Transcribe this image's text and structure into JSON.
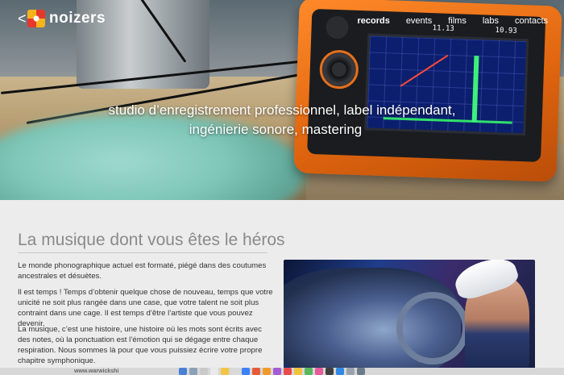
{
  "nav": {
    "back_glyph": "<",
    "brand": "noizers",
    "menu": [
      {
        "label": "records",
        "active": true
      },
      {
        "label": "events",
        "active": false
      },
      {
        "label": "films",
        "active": false
      },
      {
        "label": "labs",
        "active": false
      },
      {
        "label": "contacts",
        "active": false
      }
    ]
  },
  "hero": {
    "tagline_line1": "studio d’enregistrement professionnel, label indépendant,",
    "tagline_line2": "ingénierie sonore, mastering",
    "device_readout_1": "11.13",
    "device_readout_2": "10.93"
  },
  "main": {
    "title": "La musique dont vous êtes le héros",
    "paragraphs": [
      "Le monde phonographique actuel est formaté, piégé dans des coutumes ancestrales et désuètes.",
      "Il est temps ! Temps d’obtenir quelque chose de nouveau, temps que votre unicité ne soit plus rangée dans une case, que votre talent ne soit plus contraint dans une cage. Il est temps d’être l’artiste que vous pouvez devenir.",
      "La musique, c’est une histoire, une histoire où les mots sont écrits avec des notes, où la ponctuation est l’émotion qui se dégage entre chaque respiration. Nous sommes là pour que vous puissiez écrire votre propre chapitre symphonique."
    ]
  },
  "dock": {
    "status_text": "www.warwickshi",
    "icon_colors": [
      "#4a7fd6",
      "#8aa0b8",
      "#c9c9c9",
      "#e9e9e9",
      "#f4c542",
      "#d9d9d9",
      "#3b82f6",
      "#e55b3a",
      "#f19a2a",
      "#a35bd6",
      "#e84b4b",
      "#f2c23a",
      "#58b85b",
      "#e85a9b",
      "#3f3f3f",
      "#2f88e3",
      "#9aa3ad",
      "#6c7b8b"
    ]
  },
  "colors": {
    "accent_orange": "#e1660f",
    "title_gray": "#8a8a8a",
    "background": "#ececec"
  }
}
